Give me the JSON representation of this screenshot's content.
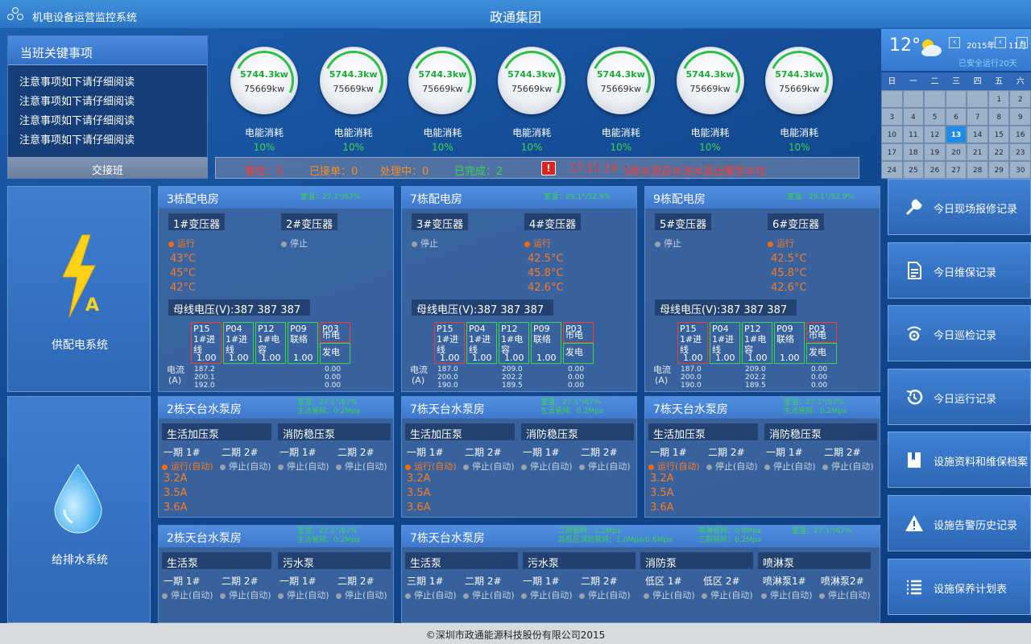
{
  "app": {
    "system_name": "机电设备运营监控系统",
    "company": "政通集团"
  },
  "notice": {
    "title": "当班关键事项",
    "items": [
      "注意事项如下请仔细阅读",
      "注意事项如下请仔细阅读",
      "注意事项如下请仔细阅读",
      "注意事项如下请仔细阅读"
    ],
    "handover_label": "交接班"
  },
  "gauges": [
    {
      "value": "5744.3kw",
      "total": "75669kw",
      "label": "电能消耗",
      "percent": "10%"
    },
    {
      "value": "5744.3kw",
      "total": "75669kw",
      "label": "电能消耗",
      "percent": "10%"
    },
    {
      "value": "5744.3kw",
      "total": "75669kw",
      "label": "电能消耗",
      "percent": "10%"
    },
    {
      "value": "5744.3kw",
      "total": "75669kw",
      "label": "电能消耗",
      "percent": "10%"
    },
    {
      "value": "5744.3kw",
      "total": "75669kw",
      "label": "电能消耗",
      "percent": "10%"
    },
    {
      "value": "5744.3kw",
      "total": "75669kw",
      "label": "电能消耗",
      "percent": "10%"
    },
    {
      "value": "5744.3kw",
      "total": "75669kw",
      "label": "电能消耗",
      "percent": "10%"
    }
  ],
  "alarm_bar": {
    "warning": "警告：5",
    "accepted": "已接单：0",
    "processing": "处理中：0",
    "done": "已完成：2",
    "icon": "alert-icon",
    "time": "17:11:19",
    "message": "5栋水泵房水池水高出警告水位"
  },
  "systems": {
    "power": "供配电系统",
    "water": "给排水系统"
  },
  "power_rooms": [
    {
      "title": "3栋配电房",
      "env": "室温：27.1°/67%",
      "t1": "1#变压器",
      "t2": "2#变压器",
      "s1": "运行",
      "s2": "停止",
      "temps": [
        "43°C",
        "45°C",
        "42°C"
      ],
      "bus": "母线电压(V):387 387 387",
      "cells": [
        {
          "code": "P15",
          "name": "1#进线",
          "val": "1.00"
        },
        {
          "code": "P04",
          "name": "1#进线",
          "val": "1.00"
        },
        {
          "code": "P12",
          "name": "1#电容",
          "val": "1.00"
        },
        {
          "code": "P09",
          "name": "联络",
          "val": "1.00"
        }
      ],
      "p03": "P03",
      "mains": "市电",
      "gen": "发电",
      "cur_label": "电流",
      "cur_unit": "(A)",
      "cur1": [
        "187.2",
        "200.1",
        "192.0"
      ],
      "cur2": [
        "0.00",
        "0.00",
        "0.00"
      ]
    },
    {
      "title": "7栋配电房",
      "env": "室温：29.1°/52.9%",
      "t1": "3#变压器",
      "t2": "4#变压器",
      "s1": "停止",
      "s2": "运行",
      "temps": [
        "42.5°C",
        "45.8°C",
        "42.6°C"
      ],
      "bus": "母线电压(V):387 387 387",
      "cells": [
        {
          "code": "P15",
          "name": "1#进线",
          "val": "1.00"
        },
        {
          "code": "P04",
          "name": "1#进线",
          "val": "1.00"
        },
        {
          "code": "P12",
          "name": "1#电容",
          "val": "1.00"
        },
        {
          "code": "P09",
          "name": "联络",
          "val": "1.00"
        }
      ],
      "p03": "P03",
      "mains": "市电",
      "gen": "发电",
      "cur_label": "电流",
      "cur_unit": "(A)",
      "cur1": [
        "187.0",
        "200.0",
        "190.0"
      ],
      "cur2": [
        "209.0",
        "202.2",
        "189.5"
      ],
      "cur3": [
        "0.00",
        "0.00",
        "0.00"
      ]
    },
    {
      "title": "9栋配电房",
      "env": "室温：29.1°/52.9%",
      "t1": "5#变压器",
      "t2": "6#变压器",
      "s1": "停止",
      "s2": "运行",
      "temps": [
        "42.5°C",
        "45.8°C",
        "42.6°C"
      ],
      "bus": "母线电压(V):387 387 387",
      "cells": [
        {
          "code": "P15",
          "name": "1#进线",
          "val": "1.00"
        },
        {
          "code": "P04",
          "name": "1#进线",
          "val": "1.00"
        },
        {
          "code": "P12",
          "name": "1#电容",
          "val": "1.00"
        },
        {
          "code": "P09",
          "name": "联络",
          "val": "1.00"
        }
      ],
      "p03": "P03",
      "mains": "市电",
      "gen": "发电",
      "cur_label": "电流",
      "cur_unit": "(A)",
      "cur1": [
        "187.0",
        "200.0",
        "190.0"
      ],
      "cur2": [
        "209.0",
        "202.2",
        "189.5"
      ],
      "cur3": [
        "0.00",
        "0.00",
        "0.00"
      ]
    }
  ],
  "pump_rooms": [
    {
      "title": "2栋天台水泵房",
      "env1": "室温：27.1°/67%",
      "env2": "生活管网：0.2Mpa",
      "g1": "生活加压泵",
      "g2": "消防稳压泵",
      "cols": [
        "一期 1#",
        "二期 2#",
        "一期 1#",
        "二期 2#"
      ],
      "states": [
        "运行(自动)",
        "停止(自动)",
        "停止(自动)",
        "停止(自动)"
      ],
      "currents": [
        "3.2A",
        "3.5A",
        "3.6A"
      ]
    },
    {
      "title": "7栋天台水泵房",
      "env1": "室温：27.1°/67%",
      "env2": "生活管网：0.2Mpa",
      "g1": "生活加压泵",
      "g2": "消防稳压泵",
      "cols": [
        "一期 1#",
        "二期 2#",
        "一期 1#",
        "二期 2#"
      ],
      "states": [
        "运行(自动)",
        "停止(自动)",
        "停止(自动)",
        "停止(自动)"
      ],
      "currents": [
        "3.2A",
        "3.5A",
        "3.6A"
      ]
    },
    {
      "title": "7栋天台水泵房",
      "env1": "室温：27.1°/67%",
      "env2": "生活管网：0.2Mpa",
      "g1": "生活加压泵",
      "g2": "消防稳压泵",
      "cols": [
        "一期 1#",
        "二期 2#",
        "一期 1#",
        "二期 2#"
      ],
      "states": [
        "运行(自动)",
        "停止(自动)",
        "停止(自动)",
        "停止(自动)"
      ],
      "currents": [
        "3.2A",
        "3.5A",
        "3.6A"
      ]
    }
  ],
  "drain_rooms": [
    {
      "title": "2栋天台水泵房",
      "env1": "室温：27.1°/67%",
      "env2": "生活管网：0.2Mpa",
      "g1": "生活泵",
      "g2": "污水泵",
      "cols": [
        "一期 1#",
        "二期 2#",
        "一期 1#",
        "二期 2#"
      ],
      "states": [
        "停止(自动)",
        "停止(自动)",
        "停止(自动)",
        "停止(自动)"
      ]
    },
    {
      "title": "7栋天台水泵房",
      "env1": "二期管网：1.2Mpa",
      "env2": "高低区消防管网：1.0Mpa/0.6Mpa",
      "env3": "喷淋管网：0.8Mpa",
      "env4": "三期管网：0.2Mpa",
      "env5": "室温：27.1°/67%",
      "g1": "生活泵",
      "g2": "污水泵",
      "g3": "消防泵",
      "g4": "喷淋泵",
      "cols": [
        "三期 1#",
        "二期 2#",
        "一期 1#",
        "二期 2#",
        "低区 1#",
        "低区 2#",
        "喷淋泵1#",
        "喷淋泵2#"
      ],
      "states": [
        "停止(自动)",
        "停止(自动)",
        "停止(自动)",
        "停止(自动)",
        "停止(自动)",
        "停止(自动)",
        "停止(自动)",
        "停止(自动)"
      ]
    }
  ],
  "weather": {
    "temp": "12°",
    "year": "2015年",
    "month": "11月",
    "safe_days": "已安全运行20天",
    "icon": "cloudy-sun-icon"
  },
  "calendar": {
    "weekdays": [
      "日",
      "一",
      "二",
      "三",
      "四",
      "五",
      "六"
    ],
    "rows": [
      [
        "",
        "",
        "",
        "",
        "",
        "1",
        "2"
      ],
      [
        "3",
        "4",
        "5",
        "6",
        "7",
        "8",
        "9"
      ],
      [
        "10",
        "11",
        "12",
        "13",
        "14",
        "15",
        "16"
      ],
      [
        "17",
        "18",
        "19",
        "20",
        "21",
        "22",
        "23"
      ],
      [
        "24",
        "25",
        "26",
        "27",
        "28",
        "29",
        "30"
      ]
    ],
    "today": "13"
  },
  "nav": [
    {
      "label": "今日现场报修记录",
      "icon": "wrench-icon"
    },
    {
      "label": "今日维保记录",
      "icon": "document-icon"
    },
    {
      "label": "今日巡检记录",
      "icon": "patrol-icon"
    },
    {
      "label": "今日运行记录",
      "icon": "history-icon"
    },
    {
      "label": "设施资料和维保档案",
      "icon": "archive-icon"
    },
    {
      "label": "设施告警历史记录",
      "icon": "warning-icon"
    },
    {
      "label": "设施保养计划表",
      "icon": "list-icon"
    }
  ],
  "footer": "©深圳市政通能源科技股份有限公司2015"
}
